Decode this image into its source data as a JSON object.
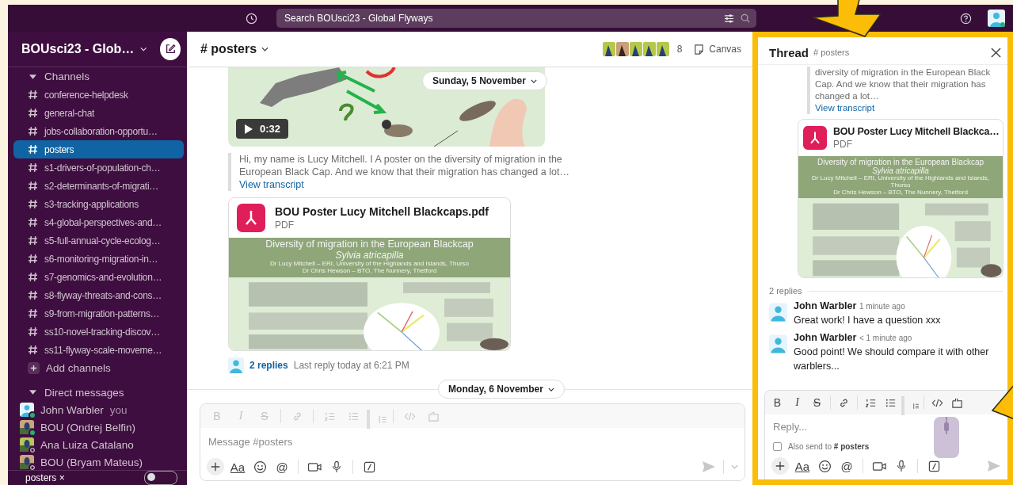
{
  "top_bar": {
    "search": {
      "placeholder": "Search BOUsci23 - Global Flyways"
    }
  },
  "sidebar": {
    "workspace": "BOUsci23 - Glob…",
    "channels_section": {
      "title": "Channels",
      "expanded": true
    },
    "channels": [
      {
        "name": "conference-helpdesk",
        "selected": false
      },
      {
        "name": "general-chat",
        "selected": false
      },
      {
        "name": "jobs-collaboration-opportu…",
        "selected": false
      },
      {
        "name": "posters",
        "selected": true
      },
      {
        "name": "s1-drivers-of-population-ch…",
        "selected": false
      },
      {
        "name": "s2-determinants-of-migrati…",
        "selected": false
      },
      {
        "name": "s3-tracking-applications",
        "selected": false
      },
      {
        "name": "s4-global-perspectives-and…",
        "selected": false
      },
      {
        "name": "s5-full-annual-cycle-ecolog…",
        "selected": false
      },
      {
        "name": "s6-monitoring-migration-in…",
        "selected": false
      },
      {
        "name": "s7-genomics-and-evolution…",
        "selected": false
      },
      {
        "name": "s8-flyway-threats-and-cons…",
        "selected": false
      },
      {
        "name": "s9-from-migration-patterns…",
        "selected": false
      },
      {
        "name": "ss10-novel-tracking-discov…",
        "selected": false
      },
      {
        "name": "ss11-flyway-scale-moveme…",
        "selected": false
      }
    ],
    "add_channels": "Add channels",
    "dm_section": {
      "title": "Direct messages",
      "expanded": true
    },
    "direct_messages": [
      {
        "name": "John Warbler",
        "note": "you",
        "online": true,
        "kind": "person"
      },
      {
        "name": "BOU (Ondrej Belfin)",
        "online": true
      },
      {
        "name": "Ana Luiza Catalano",
        "online": false
      },
      {
        "name": "BOU (Bryam Mateus)",
        "online": false
      }
    ],
    "footer": {
      "tab": "posters",
      "close": "×",
      "toggle": {
        "on": false
      }
    }
  },
  "channel_header": {
    "name": "# posters",
    "member_count": "8",
    "canvas": "Canvas"
  },
  "message": {
    "video": {
      "duration": "0:32"
    },
    "date_pill": "Sunday, 5 November",
    "transcript": "Hi, my name is Lucy Mitchell. I A poster on the diversity of migration in the European Black Cap. And we know that their migration has changed a lot…",
    "transcript_link": "View transcript",
    "file": {
      "name": "BOU Poster Lucy Mitchell Blackcaps.pdf",
      "type": "PDF",
      "poster": {
        "title": "Diversity of migration in the European Blackcap",
        "species": "Sylvia atricapilla",
        "authors": [
          "Dr Lucy Mitchell – ERI, University of the Highlands and Islands, Thurso",
          "Dr Chris Hewson – BTO, The Nunnery, Thetford"
        ]
      }
    },
    "replies": {
      "count": "2 replies",
      "last": "Last reply today at 6:21 PM"
    }
  },
  "date_divider": "Monday, 6 November",
  "composer": {
    "placeholder": "Message #posters",
    "toolbar": [
      {
        "kind": "bold",
        "label": "B"
      },
      {
        "kind": "italic",
        "label": "I"
      },
      {
        "kind": "strike",
        "label": "S"
      },
      {
        "kind": "link"
      },
      {
        "kind": "numbered-list"
      },
      {
        "kind": "bulleted-list"
      },
      {
        "kind": "quote"
      },
      {
        "kind": "code"
      },
      {
        "kind": "code-block"
      }
    ],
    "actions": [
      {
        "kind": "plus"
      },
      {
        "kind": "format",
        "label": "Aa"
      },
      {
        "kind": "emoji"
      },
      {
        "kind": "mention",
        "label": "@"
      },
      {
        "kind": "video"
      },
      {
        "kind": "audio"
      },
      {
        "kind": "shortcuts"
      }
    ]
  },
  "thread": {
    "title": "Thread",
    "channel": "# posters",
    "transcript": "diversity of migration in the European Black Cap. And we know that their migration has changed a lot…",
    "transcript_link": "View transcript",
    "file": {
      "name": "BOU Poster Lucy Mitchell Blackca…",
      "type": "PDF",
      "poster": {
        "title": "Diversity of migration in the European Blackcap",
        "species": "Sylvia atricapilla",
        "authors": [
          "Dr Lucy Mitchell – ERI, University of the Highlands and Islands, Thurso",
          "Dr Chris Hewson – BTO, The Nunnery, Thetford"
        ]
      }
    },
    "replies_label": "2 replies",
    "replies": [
      {
        "author": "John Warbler",
        "time": "1 minute ago",
        "text": "Great work! I have a question xxx"
      },
      {
        "author": "John Warbler",
        "time": "< 1 minute ago",
        "text": "Good point! We should compare it with other warblers..."
      }
    ],
    "composer": {
      "placeholder": "Reply...",
      "also_send": {
        "label": "Also send to **# posters**",
        "checked": false
      },
      "toolbar": [
        {
          "kind": "bold",
          "label": "B"
        },
        {
          "kind": "italic",
          "label": "I"
        },
        {
          "kind": "strike",
          "label": "S"
        },
        {
          "kind": "link"
        },
        {
          "kind": "numbered-list"
        },
        {
          "kind": "bulleted-list"
        },
        {
          "kind": "quote"
        },
        {
          "kind": "code"
        },
        {
          "kind": "code-block"
        }
      ],
      "actions": [
        {
          "kind": "plus"
        },
        {
          "kind": "format",
          "label": "Aa"
        },
        {
          "kind": "emoji"
        },
        {
          "kind": "mention",
          "label": "@"
        },
        {
          "kind": "video"
        },
        {
          "kind": "audio"
        },
        {
          "kind": "shortcuts"
        }
      ]
    }
  }
}
